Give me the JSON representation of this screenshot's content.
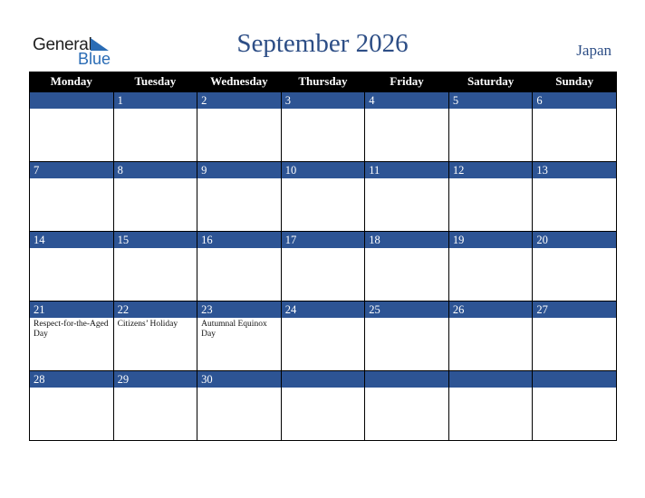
{
  "logo": {
    "word1": "General",
    "word2": "Blue"
  },
  "title": "September 2026",
  "country": "Japan",
  "colors": {
    "header_bg": "#000000",
    "date_band": "#2d5494",
    "title": "#2d4e86",
    "logo_blue": "#2a6cb5"
  },
  "weekdays": [
    "Monday",
    "Tuesday",
    "Wednesday",
    "Thursday",
    "Friday",
    "Saturday",
    "Sunday"
  ],
  "weeks": [
    [
      {
        "day": ""
      },
      {
        "day": "1"
      },
      {
        "day": "2"
      },
      {
        "day": "3"
      },
      {
        "day": "4"
      },
      {
        "day": "5"
      },
      {
        "day": "6"
      }
    ],
    [
      {
        "day": "7"
      },
      {
        "day": "8"
      },
      {
        "day": "9"
      },
      {
        "day": "10"
      },
      {
        "day": "11"
      },
      {
        "day": "12"
      },
      {
        "day": "13"
      }
    ],
    [
      {
        "day": "14"
      },
      {
        "day": "15"
      },
      {
        "day": "16"
      },
      {
        "day": "17"
      },
      {
        "day": "18"
      },
      {
        "day": "19"
      },
      {
        "day": "20"
      }
    ],
    [
      {
        "day": "21",
        "holiday": "Respect-for-the-Aged Day"
      },
      {
        "day": "22",
        "holiday": "Citizens’ Holiday"
      },
      {
        "day": "23",
        "holiday": "Autumnal Equinox Day"
      },
      {
        "day": "24"
      },
      {
        "day": "25"
      },
      {
        "day": "26"
      },
      {
        "day": "27"
      }
    ],
    [
      {
        "day": "28"
      },
      {
        "day": "29"
      },
      {
        "day": "30"
      },
      {
        "day": ""
      },
      {
        "day": ""
      },
      {
        "day": ""
      },
      {
        "day": ""
      }
    ]
  ]
}
